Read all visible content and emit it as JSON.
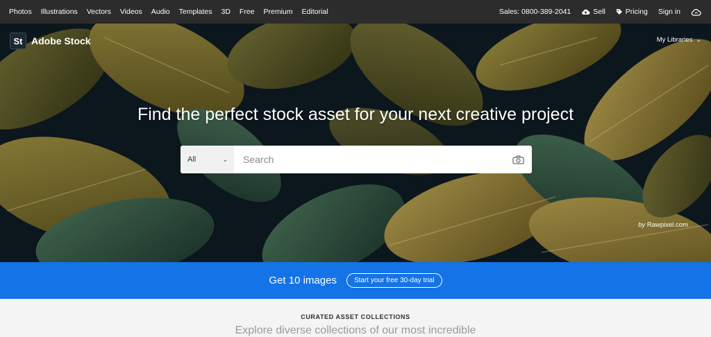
{
  "nav": {
    "left_items": [
      "Photos",
      "Illustrations",
      "Vectors",
      "Videos",
      "Audio",
      "Templates",
      "3D",
      "Free",
      "Premium",
      "Editorial"
    ],
    "sales": "Sales: 0800-389-2041",
    "sell": "Sell",
    "pricing": "Pricing",
    "signin": "Sign in"
  },
  "brand": {
    "logo": "St",
    "name": "Adobe Stock"
  },
  "my_libraries": "My Libraries",
  "hero": {
    "headline": "Find the perfect stock asset for your next creative project",
    "credit_prefix": "by",
    "credit_name": "Rawpixel.com"
  },
  "search": {
    "filter_value": "All",
    "placeholder": "Search"
  },
  "promo": {
    "text": "Get 10 images",
    "button": "Start your free 30-day trial"
  },
  "curated": {
    "eyebrow": "CURATED ASSET COLLECTIONS",
    "subtitle": "Explore diverse collections of our most incredible"
  },
  "colors": {
    "nav_bg": "#2c2c2c",
    "promo_bg": "#1473e6",
    "hero_dark": "#101c26"
  },
  "icons": [
    "cloud-upload-icon",
    "tag-icon",
    "creative-cloud-icon",
    "chevron-down-icon",
    "camera-icon"
  ]
}
